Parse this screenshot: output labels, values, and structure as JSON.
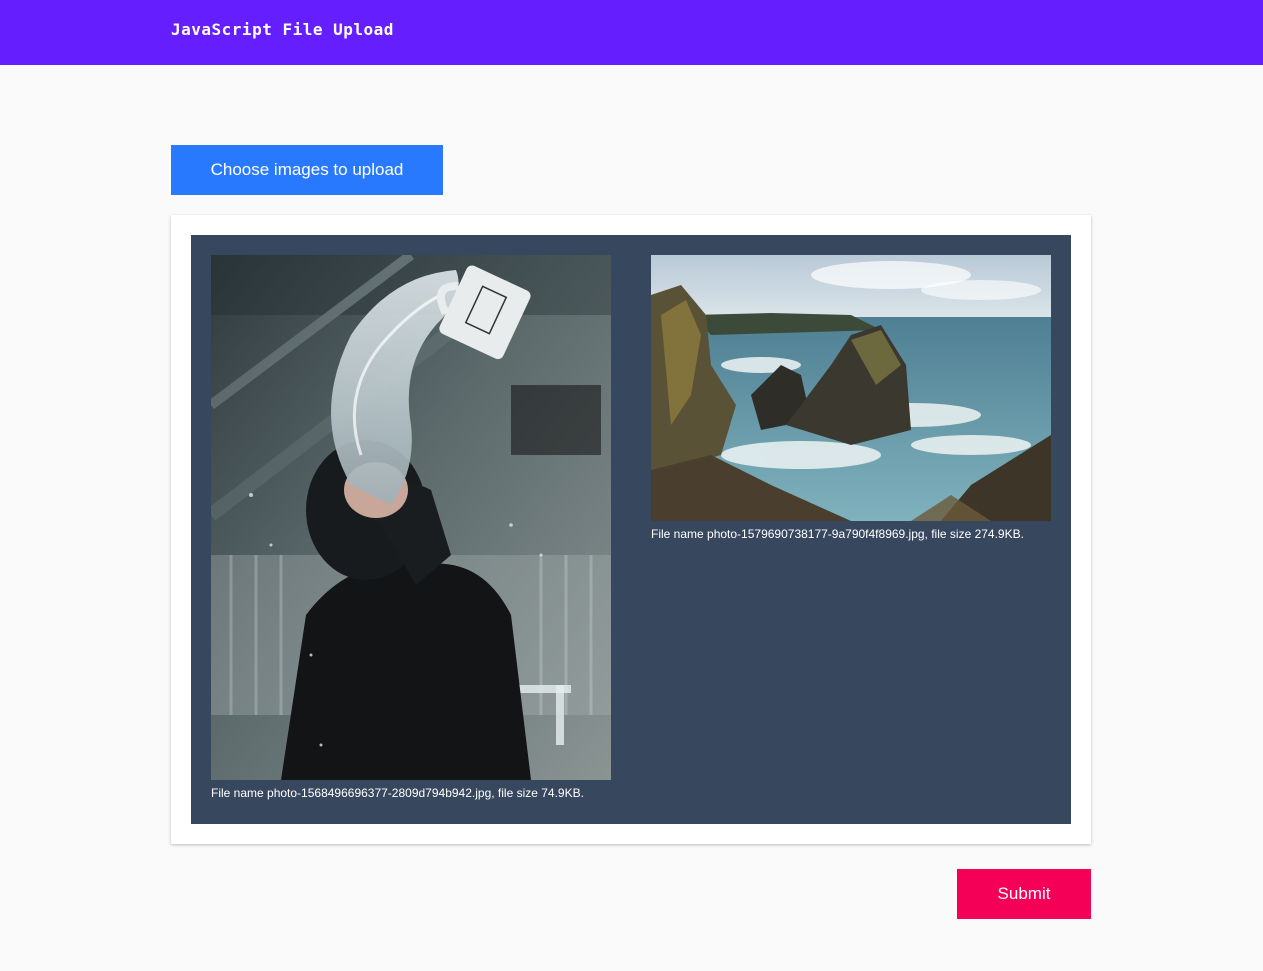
{
  "header": {
    "title": "JavaScript File Upload",
    "background_color": "#651fff"
  },
  "upload": {
    "choose_label": "Choose images to upload",
    "button_color": "#2979ff"
  },
  "previews": [
    {
      "image": "photo-water-mug-icon",
      "caption": "File name photo-1568496696377-2809d794b942.jpg, file size 74.9KB."
    },
    {
      "image": "photo-coastal-cliffs-icon",
      "caption": "File name photo-1579690738177-9a790f4f8969.jpg, file size 274.9KB."
    }
  ],
  "preview_background": "#37475e",
  "actions": {
    "submit_label": "Submit",
    "submit_color": "#f50057"
  }
}
